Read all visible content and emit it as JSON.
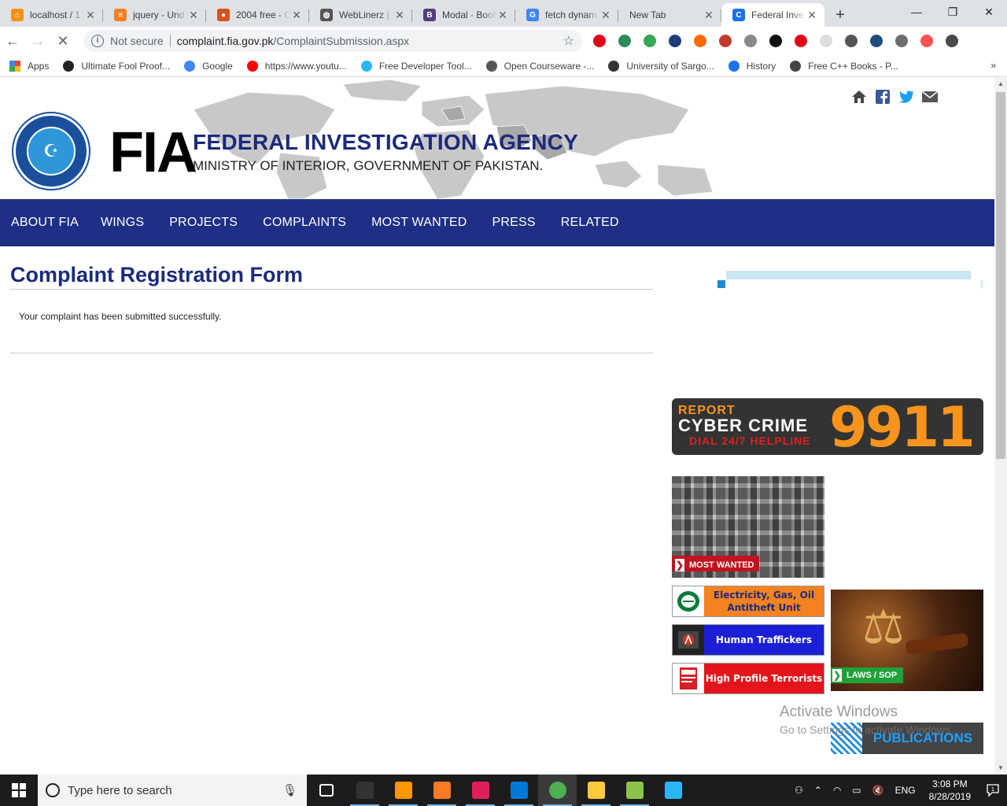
{
  "browser": {
    "tabs": [
      {
        "title": "localhost / 1",
        "fav_color": "#f29111",
        "fav_glyph": "⌂"
      },
      {
        "title": "jquery - Und",
        "fav_color": "#f48024",
        "fav_glyph": "≡"
      },
      {
        "title": "2004 free - O",
        "fav_color": "#d9531e",
        "fav_glyph": "●"
      },
      {
        "title": "WebLinerz | I",
        "fav_color": "#555555",
        "fav_glyph": "◍"
      },
      {
        "title": "Modal · Boot",
        "fav_color": "#563d7c",
        "fav_glyph": "B"
      },
      {
        "title": "fetch dynam",
        "fav_color": "#4285f4",
        "fav_glyph": "G"
      },
      {
        "title": "New Tab",
        "fav_color": "",
        "fav_glyph": ""
      },
      {
        "title": "Federal Inves",
        "fav_color": "#1a73e8",
        "fav_glyph": "C"
      }
    ],
    "active_tab": 7,
    "new_tab": "+",
    "window_controls": {
      "min": "—",
      "max": "❐",
      "close": "✕"
    },
    "security_label": "Not secure",
    "url_host": "complaint.fia.gov.pk",
    "url_path": "/ComplaintSubmission.aspx",
    "extension_colors": [
      "#e2001a",
      "#2e8b57",
      "#34a853",
      "#1c3d7a",
      "#ff6a00",
      "#c0392b",
      "#888888",
      "#111111",
      "#e2001a",
      "#dddddd",
      "#555555",
      "#1f4e79",
      "#6d6d6d",
      "#ff5252",
      "#4a4a4a"
    ],
    "bookmarks": [
      {
        "label": "Apps",
        "color": "#ea4335"
      },
      {
        "label": "Ultimate Fool Proof...",
        "color": "#222222"
      },
      {
        "label": "Google",
        "color": "#4285f4"
      },
      {
        "label": "https://www.youtu...",
        "color": "#ff0000"
      },
      {
        "label": "Free Developer Tool...",
        "color": "#29b6f6"
      },
      {
        "label": "Open Courseware -...",
        "color": "#555555"
      },
      {
        "label": "University of Sargo...",
        "color": "#333333"
      },
      {
        "label": "History",
        "color": "#1a73e8"
      },
      {
        "label": "Free C++ Books - P...",
        "color": "#444444"
      }
    ],
    "bookmarks_more": "»"
  },
  "site": {
    "logo_text": "FIA",
    "title": "FEDERAL INVESTIGATION AGENCY",
    "subtitle": "MINISTRY OF INTERIOR, GOVERNMENT OF PAKISTAN.",
    "seal_text": "MINISTRY OF INTERIOR · FEDERAL INVESTIGATION AGENCY PAKISTAN",
    "nav": [
      "ABOUT FIA",
      "WINGS",
      "PROJECTS",
      "COMPLAINTS",
      "MOST WANTED",
      "PRESS",
      "RELATED"
    ]
  },
  "main": {
    "form_title": "Complaint Registration Form",
    "message": "Your complaint has been submitted successfully."
  },
  "sidebar": {
    "cyber": {
      "line1": "REPORT",
      "line2": "CYBER CRIME",
      "line3": "DIAL 24/7 HELPLINE",
      "number": "9911"
    },
    "most_wanted": "MOST WANTED",
    "electricity": "Electricity, Gas, Oil Antitheft Unit",
    "human": "Human Traffickers",
    "terrorists": "High Profile Terrorists",
    "laws": "LAWS / SOP",
    "publications": "PUBLICATIONS"
  },
  "watermark": {
    "line1": "Activate Windows",
    "line2": "Go to Settings to activate Windows."
  },
  "taskbar": {
    "search_placeholder": "Type here to search",
    "apps": [
      {
        "name": "task-view",
        "color": "#ffffff"
      },
      {
        "name": "cmd",
        "color": "#333333"
      },
      {
        "name": "sublime",
        "color": "#ff9800"
      },
      {
        "name": "xampp",
        "color": "#fb7a24"
      },
      {
        "name": "slack",
        "color": "#e01e5a"
      },
      {
        "name": "app-blue",
        "color": "#0078d7"
      },
      {
        "name": "chrome",
        "color": "#4caf50"
      },
      {
        "name": "file-explorer",
        "color": "#ffc83d"
      },
      {
        "name": "notepad-plus",
        "color": "#8bc34a"
      },
      {
        "name": "paint",
        "color": "#29b6f6"
      }
    ],
    "language": "ENG",
    "time": "3:08 PM",
    "date": "8/28/2019",
    "notification_count": "1"
  }
}
